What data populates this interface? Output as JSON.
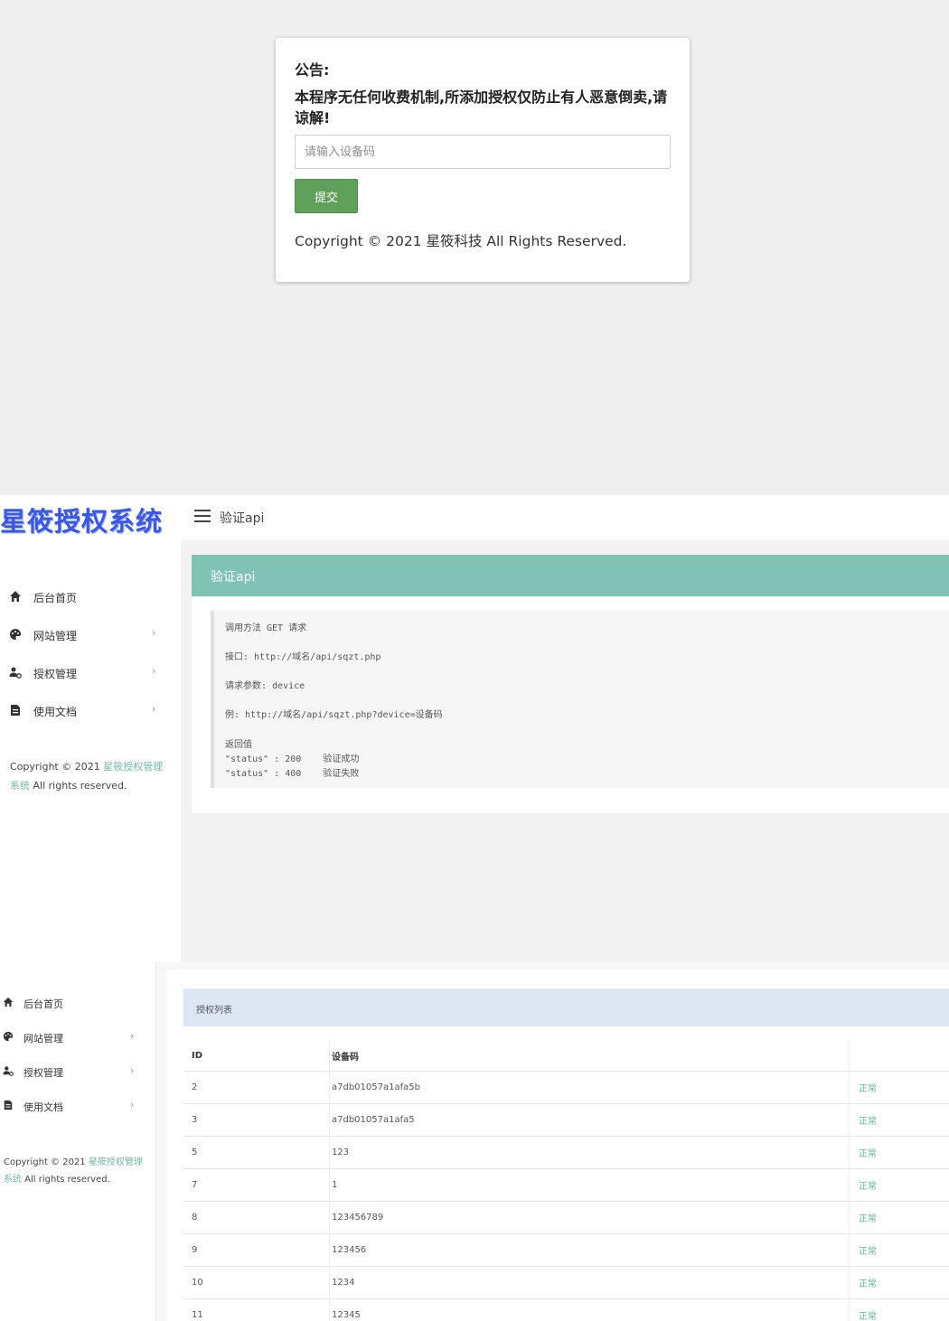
{
  "notice": {
    "title": "公告:",
    "message": "本程序无任何收费机制,所添加授权仅防止有人恶意倒卖,请谅解!",
    "input_placeholder": "请输入设备码",
    "submit_label": "提交",
    "copyright": "Copyright © 2021 星筱科技 All Rights Reserved."
  },
  "app": {
    "logo_text": "星筱授权系统",
    "page_title": "验证api",
    "sidebar": {
      "items": [
        {
          "label": "后台首页",
          "icon": "home-icon",
          "has_arrow": false
        },
        {
          "label": "网站管理",
          "icon": "palette-icon",
          "has_arrow": true,
          "arrow": "›"
        },
        {
          "label": "授权管理",
          "icon": "user-gear-icon",
          "has_arrow": true,
          "arrow": "›"
        },
        {
          "label": "使用文档",
          "icon": "document-icon",
          "has_arrow": true,
          "arrow": "›"
        }
      ],
      "copyright_prefix": "Copyright © 2021 ",
      "copyright_link": "星筱授权管理系统",
      "copyright_suffix": " All rights reserved."
    },
    "api_card": {
      "header": "验证api",
      "lines": {
        "method": "调用方法 GET 请求",
        "endpoint": "接口: http://域名/api/sqzt.php",
        "params": "请求参数: device",
        "example": "例: http://域名/api/sqzt.php?device=设备码",
        "return_title": "返回值",
        "return_ok": "\"status\" : 200    验证成功",
        "return_fail": "\"status\" : 400    验证失败"
      }
    }
  },
  "license_list": {
    "panel_title": "授权列表",
    "columns": {
      "id": "ID",
      "device": "设备码",
      "status": ""
    },
    "rows": [
      {
        "id": "2",
        "device": "a7db01057a1afa5b",
        "status": "正常"
      },
      {
        "id": "3",
        "device": "a7db01057a1afa5",
        "status": "正常"
      },
      {
        "id": "5",
        "device": "123",
        "status": "正常"
      },
      {
        "id": "7",
        "device": "1",
        "status": "正常"
      },
      {
        "id": "8",
        "device": "123456789",
        "status": "正常"
      },
      {
        "id": "9",
        "device": "123456",
        "status": "正常"
      },
      {
        "id": "10",
        "device": "1234",
        "status": "正常"
      },
      {
        "id": "11",
        "device": "12345",
        "status": "正常"
      }
    ]
  },
  "colors": {
    "accent_teal": "#80c2b4",
    "submit_green": "#5fa05a",
    "logo_blue": "#3b57e5",
    "status_green": "#58b39a"
  }
}
